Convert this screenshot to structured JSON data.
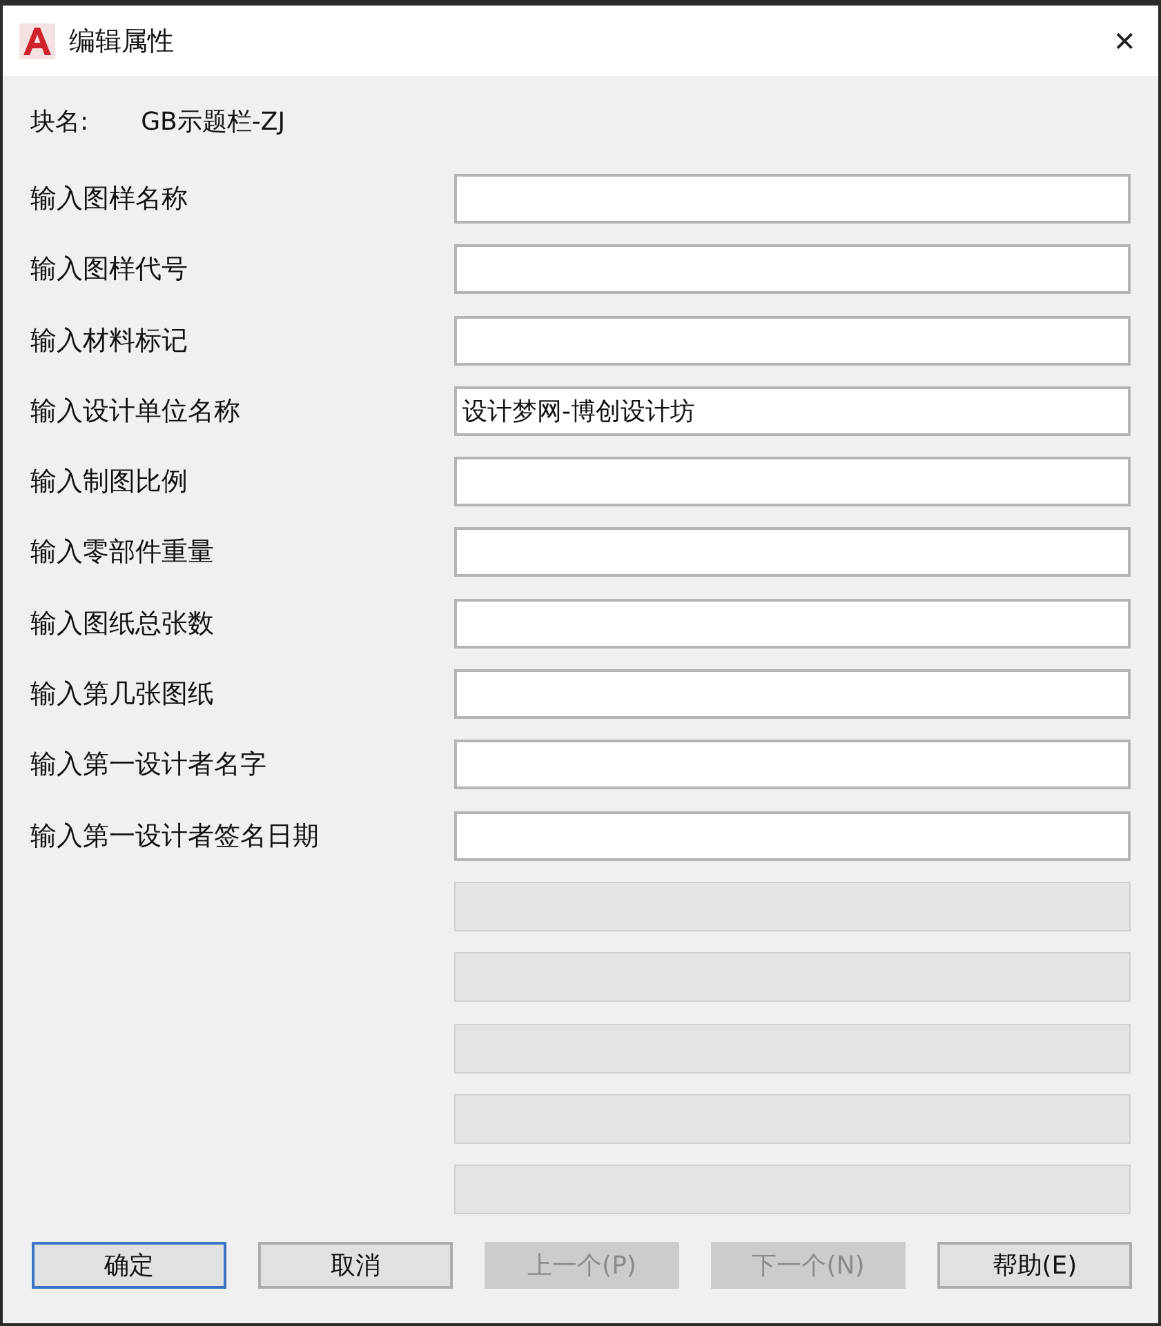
{
  "window": {
    "title": "编辑属性",
    "close": "✕"
  },
  "block_name": {
    "label": "块名:",
    "value": "GB示题栏-ZJ"
  },
  "fields": [
    {
      "label": "输入图样名称",
      "disabled": false
    },
    {
      "label": "输入图样代号",
      "disabled": false
    },
    {
      "label": "输入材料标记",
      "disabled": false
    },
    {
      "label": "输入设计单位名称",
      "value": "设计梦网-博创设计坊",
      "disabled": false
    },
    {
      "label": "输入制图比例",
      "disabled": false
    },
    {
      "label": "输入零部件重量",
      "disabled": false
    },
    {
      "label": "输入图纸总张数",
      "disabled": false
    },
    {
      "label": "输入第几张图纸",
      "disabled": false
    },
    {
      "label": "输入第一设计者名字",
      "disabled": false
    },
    {
      "label": "输入第一设计者签名日期",
      "disabled": false
    },
    {
      "disabled": true
    },
    {
      "disabled": true
    },
    {
      "disabled": true
    },
    {
      "disabled": true
    },
    {
      "disabled": true
    }
  ],
  "buttons": [
    {
      "label": "确定",
      "disabled": false,
      "default": true
    },
    {
      "label": "取消",
      "disabled": false,
      "default": false
    },
    {
      "label": "上一个(P)",
      "disabled": true,
      "default": false
    },
    {
      "label": "下一个(N)",
      "disabled": true,
      "default": false
    },
    {
      "label": "帮助(E)",
      "disabled": false,
      "default": false
    }
  ]
}
